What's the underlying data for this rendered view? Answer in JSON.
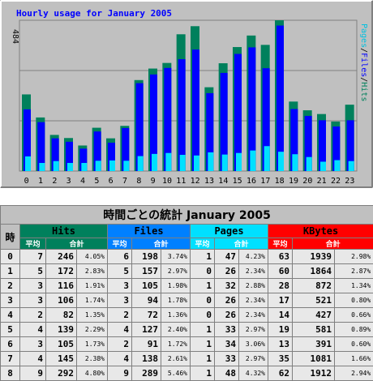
{
  "chart_data": {
    "type": "bar",
    "title": "Hourly usage for January 2005",
    "ymax_label": "484",
    "legend": [
      "Pages",
      "Files",
      "Hits"
    ],
    "legend_sep": "/",
    "categories": [
      "0",
      "1",
      "2",
      "3",
      "4",
      "5",
      "6",
      "7",
      "8",
      "9",
      "10",
      "11",
      "12",
      "13",
      "14",
      "15",
      "16",
      "17",
      "18",
      "19",
      "20",
      "21",
      "22",
      "23"
    ],
    "ylim": [
      0,
      484
    ],
    "grid": true,
    "series": [
      {
        "name": "Hits",
        "color": "#00805c",
        "values": [
          246,
          172,
          116,
          106,
          82,
          139,
          105,
          145,
          292,
          329,
          347,
          439,
          465,
          269,
          346,
          398,
          435,
          405,
          484,
          223,
          195,
          183,
          159,
          213
        ]
      },
      {
        "name": "Files",
        "color": "#0000ff",
        "values": [
          198,
          157,
          105,
          94,
          72,
          127,
          91,
          138,
          282,
          310,
          331,
          359,
          390,
          250,
          315,
          376,
          397,
          330,
          467,
          199,
          177,
          163,
          143,
          163
        ]
      },
      {
        "name": "Pages",
        "color": "#00e0ff",
        "values": [
          47,
          26,
          32,
          26,
          26,
          33,
          34,
          33,
          48,
          55,
          58,
          52,
          50,
          60,
          53,
          58,
          66,
          80,
          62,
          54,
          45,
          30,
          35,
          32
        ]
      }
    ]
  },
  "table": {
    "title": "時間ごとの統計 January 2005",
    "hour_header": "時",
    "groups": {
      "hits": "Hits",
      "files": "Files",
      "pages": "Pages",
      "kbytes": "KBytes"
    },
    "avg_label": "平均",
    "total_label": "合計",
    "rows": [
      {
        "hour": "0",
        "ha": "7",
        "ht": "246",
        "hp": "4.05%",
        "fa": "6",
        "ft": "198",
        "fp": "3.74%",
        "pa": "1",
        "pt": "47",
        "pp": "4.23%",
        "ka": "63",
        "kt": "1939",
        "kp": "2.98%"
      },
      {
        "hour": "1",
        "ha": "5",
        "ht": "172",
        "hp": "2.83%",
        "fa": "5",
        "ft": "157",
        "fp": "2.97%",
        "pa": "0",
        "pt": "26",
        "pp": "2.34%",
        "ka": "60",
        "kt": "1864",
        "kp": "2.87%"
      },
      {
        "hour": "2",
        "ha": "3",
        "ht": "116",
        "hp": "1.91%",
        "fa": "3",
        "ft": "105",
        "fp": "1.98%",
        "pa": "1",
        "pt": "32",
        "pp": "2.88%",
        "ka": "28",
        "kt": "872",
        "kp": "1.34%"
      },
      {
        "hour": "3",
        "ha": "3",
        "ht": "106",
        "hp": "1.74%",
        "fa": "3",
        "ft": "94",
        "fp": "1.78%",
        "pa": "0",
        "pt": "26",
        "pp": "2.34%",
        "ka": "17",
        "kt": "521",
        "kp": "0.80%"
      },
      {
        "hour": "4",
        "ha": "2",
        "ht": "82",
        "hp": "1.35%",
        "fa": "2",
        "ft": "72",
        "fp": "1.36%",
        "pa": "0",
        "pt": "26",
        "pp": "2.34%",
        "ka": "14",
        "kt": "427",
        "kp": "0.66%"
      },
      {
        "hour": "5",
        "ha": "4",
        "ht": "139",
        "hp": "2.29%",
        "fa": "4",
        "ft": "127",
        "fp": "2.40%",
        "pa": "1",
        "pt": "33",
        "pp": "2.97%",
        "ka": "19",
        "kt": "581",
        "kp": "0.89%"
      },
      {
        "hour": "6",
        "ha": "3",
        "ht": "105",
        "hp": "1.73%",
        "fa": "2",
        "ft": "91",
        "fp": "1.72%",
        "pa": "1",
        "pt": "34",
        "pp": "3.06%",
        "ka": "13",
        "kt": "391",
        "kp": "0.60%"
      },
      {
        "hour": "7",
        "ha": "4",
        "ht": "145",
        "hp": "2.38%",
        "fa": "4",
        "ft": "138",
        "fp": "2.61%",
        "pa": "1",
        "pt": "33",
        "pp": "2.97%",
        "ka": "35",
        "kt": "1081",
        "kp": "1.66%"
      },
      {
        "hour": "8",
        "ha": "9",
        "ht": "292",
        "hp": "4.80%",
        "fa": "9",
        "ft": "289",
        "fp": "5.46%",
        "pa": "1",
        "pt": "48",
        "pp": "4.32%",
        "ka": "62",
        "kt": "1912",
        "kp": "2.94%"
      }
    ]
  }
}
